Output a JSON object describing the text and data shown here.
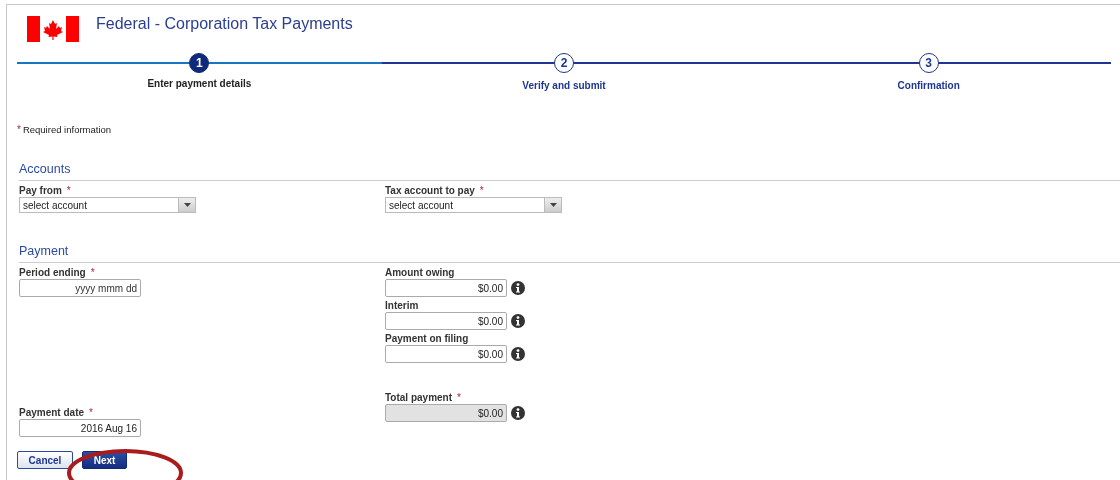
{
  "header": {
    "title": "Federal - Corporation Tax Payments"
  },
  "steps": [
    {
      "number": "1",
      "label": "Enter payment details",
      "selected": true
    },
    {
      "number": "2",
      "label": "Verify and submit",
      "selected": false
    },
    {
      "number": "3",
      "label": "Confirmation",
      "selected": false
    }
  ],
  "required_note": {
    "marker": "*",
    "text": "Required information"
  },
  "accounts": {
    "title": "Accounts",
    "fields": [
      {
        "label": "Pay from",
        "required": true,
        "value": "select account"
      },
      {
        "label": "Tax account to pay",
        "required": true,
        "value": "select account"
      }
    ]
  },
  "payment": {
    "title": "Payment",
    "left": [
      {
        "label": "Period ending",
        "required": true,
        "placeholder": "yyyy mmm dd",
        "disabled": false,
        "info": false
      },
      {
        "label": "Payment date",
        "required": true,
        "value": "2016 Aug 16",
        "disabled": false,
        "info": false
      }
    ],
    "right": [
      {
        "label": "Amount owing",
        "required": false,
        "value": "$0.00",
        "disabled": false,
        "info": true
      },
      {
        "label": "Interim",
        "required": false,
        "value": "$0.00",
        "disabled": false,
        "info": true
      },
      {
        "label": "Payment on filing",
        "required": false,
        "value": "$0.00",
        "disabled": false,
        "info": true
      },
      {
        "label": "Total payment",
        "required": true,
        "value": "$0.00",
        "disabled": true,
        "info": true
      }
    ]
  },
  "buttons": [
    {
      "label": "Cancel",
      "kind": "secondary"
    },
    {
      "label": "Next",
      "kind": "primary"
    }
  ]
}
